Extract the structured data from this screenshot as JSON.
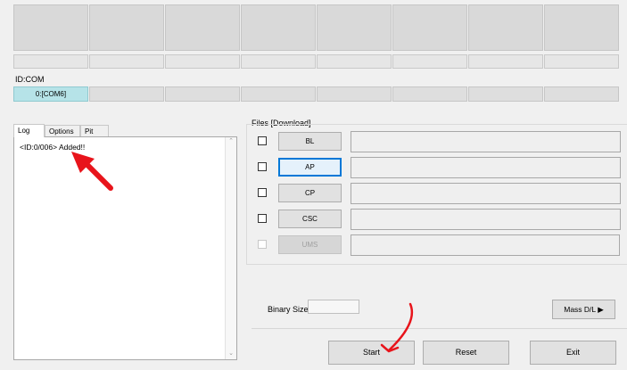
{
  "id_com_label": "ID:COM",
  "com_ports": [
    "0:[COM6]",
    "",
    "",
    "",
    "",
    "",
    "",
    ""
  ],
  "tabs": [
    "Log",
    "Options",
    "Pit"
  ],
  "log": {
    "text": "<ID:0/006> Added!!"
  },
  "files": {
    "group_label": "Files [Download]",
    "rows": [
      {
        "label": "BL"
      },
      {
        "label": "AP"
      },
      {
        "label": "CP"
      },
      {
        "label": "CSC"
      },
      {
        "label": "UMS"
      }
    ]
  },
  "binary_size_label": "Binary Size",
  "mass_dl_label": "Mass D/L ▶",
  "buttons": {
    "start": "Start",
    "reset": "Reset",
    "exit": "Exit"
  },
  "annotation_color": "#e8141b"
}
